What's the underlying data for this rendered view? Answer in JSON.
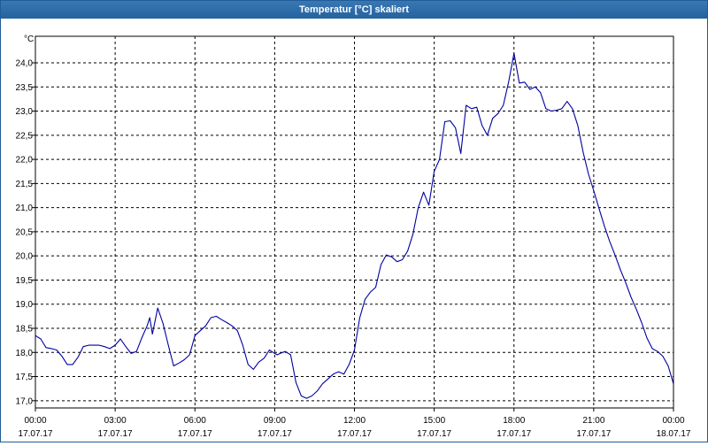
{
  "window": {
    "title": "Temperatur [°C] skaliert"
  },
  "colors": {
    "title_bar": "#2a68a6",
    "title_text": "#ffffff",
    "line": "#0000a0",
    "grid": "#000000"
  },
  "chart_data": {
    "type": "line",
    "title": "Temperatur [°C] skaliert",
    "ylabel": "°C",
    "xlabel": "",
    "ylim": [
      16.85,
      24.55
    ],
    "xlim_hours": [
      0,
      24
    ],
    "grid": true,
    "grid_style": "dashed",
    "y_ticks": [
      "17,0",
      "17,5",
      "18,0",
      "18,5",
      "19,0",
      "19,5",
      "20,0",
      "20,5",
      "21,0",
      "21,5",
      "22,0",
      "22,5",
      "23,0",
      "23,5",
      "24,0"
    ],
    "x_ticks": [
      {
        "time": "00:00",
        "date": "17.07.17"
      },
      {
        "time": "03:00",
        "date": "17.07.17"
      },
      {
        "time": "06:00",
        "date": "17.07.17"
      },
      {
        "time": "09:00",
        "date": "17.07.17"
      },
      {
        "time": "12:00",
        "date": "17.07.17"
      },
      {
        "time": "15:00",
        "date": "17.07.17"
      },
      {
        "time": "18:00",
        "date": "17.07.17"
      },
      {
        "time": "21:00",
        "date": "17.07.17"
      },
      {
        "time": "00:00",
        "date": "18.07.17"
      }
    ],
    "series": [
      {
        "x_hours": [
          0,
          0.2,
          0.4,
          0.6,
          0.8,
          1.0,
          1.2,
          1.4,
          1.6,
          1.8,
          2.0,
          2.2,
          2.4,
          2.6,
          2.8,
          3.0,
          3.2,
          3.4,
          3.6,
          3.8,
          4.0,
          4.2,
          4.3,
          4.4,
          4.6,
          4.8,
          5.0,
          5.2,
          5.4,
          5.6,
          5.8,
          6.0,
          6.2,
          6.4,
          6.6,
          6.8,
          7.0,
          7.2,
          7.4,
          7.6,
          7.8,
          8.0,
          8.2,
          8.4,
          8.6,
          8.8,
          9.0,
          9.1,
          9.2,
          9.4,
          9.6,
          9.8,
          10.0,
          10.2,
          10.4,
          10.6,
          10.8,
          11.0,
          11.2,
          11.4,
          11.6,
          11.8,
          12.0,
          12.2,
          12.4,
          12.6,
          12.8,
          13.0,
          13.2,
          13.4,
          13.6,
          13.8,
          14.0,
          14.2,
          14.4,
          14.6,
          14.8,
          15.0,
          15.2,
          15.4,
          15.6,
          15.8,
          16.0,
          16.2,
          16.4,
          16.6,
          16.8,
          17.0,
          17.2,
          17.4,
          17.6,
          17.8,
          18.0,
          18.2,
          18.4,
          18.6,
          18.8,
          19.0,
          19.2,
          19.4,
          19.6,
          19.8,
          20.0,
          20.2,
          20.4,
          20.6,
          20.8,
          21.0,
          21.2,
          21.4,
          21.6,
          21.8,
          22.0,
          22.2,
          22.4,
          22.6,
          22.8,
          23.0,
          23.2,
          23.4,
          23.6,
          23.8,
          24.0
        ],
        "y": [
          18.35,
          18.28,
          18.1,
          18.08,
          18.05,
          17.92,
          17.75,
          17.75,
          17.9,
          18.12,
          18.15,
          18.15,
          18.15,
          18.12,
          18.08,
          18.15,
          18.28,
          18.12,
          17.98,
          18.02,
          18.3,
          18.55,
          18.72,
          18.38,
          18.92,
          18.6,
          18.15,
          17.72,
          17.78,
          17.85,
          17.95,
          18.35,
          18.45,
          18.55,
          18.72,
          18.75,
          18.68,
          18.62,
          18.55,
          18.45,
          18.15,
          17.75,
          17.65,
          17.8,
          17.88,
          18.05,
          17.98,
          17.95,
          17.98,
          18.02,
          17.95,
          17.38,
          17.1,
          17.05,
          17.1,
          17.2,
          17.35,
          17.45,
          17.55,
          17.6,
          17.55,
          17.75,
          18.05,
          18.72,
          19.1,
          19.25,
          19.35,
          19.82,
          20.02,
          19.98,
          19.88,
          19.92,
          20.1,
          20.45,
          21.0,
          21.32,
          21.05,
          21.75,
          22.0,
          22.78,
          22.8,
          22.65,
          22.12,
          23.12,
          23.05,
          23.08,
          22.7,
          22.5,
          22.85,
          22.95,
          23.12,
          23.6,
          24.2,
          23.58,
          23.6,
          23.45,
          23.5,
          23.38,
          23.05,
          23.0,
          23.02,
          23.05,
          23.2,
          23.05,
          22.7,
          22.15,
          21.7,
          21.35,
          20.98,
          20.62,
          20.3,
          20.02,
          19.72,
          19.45,
          19.15,
          18.9,
          18.62,
          18.3,
          18.08,
          18.02,
          17.92,
          17.72,
          17.35
        ]
      }
    ]
  }
}
